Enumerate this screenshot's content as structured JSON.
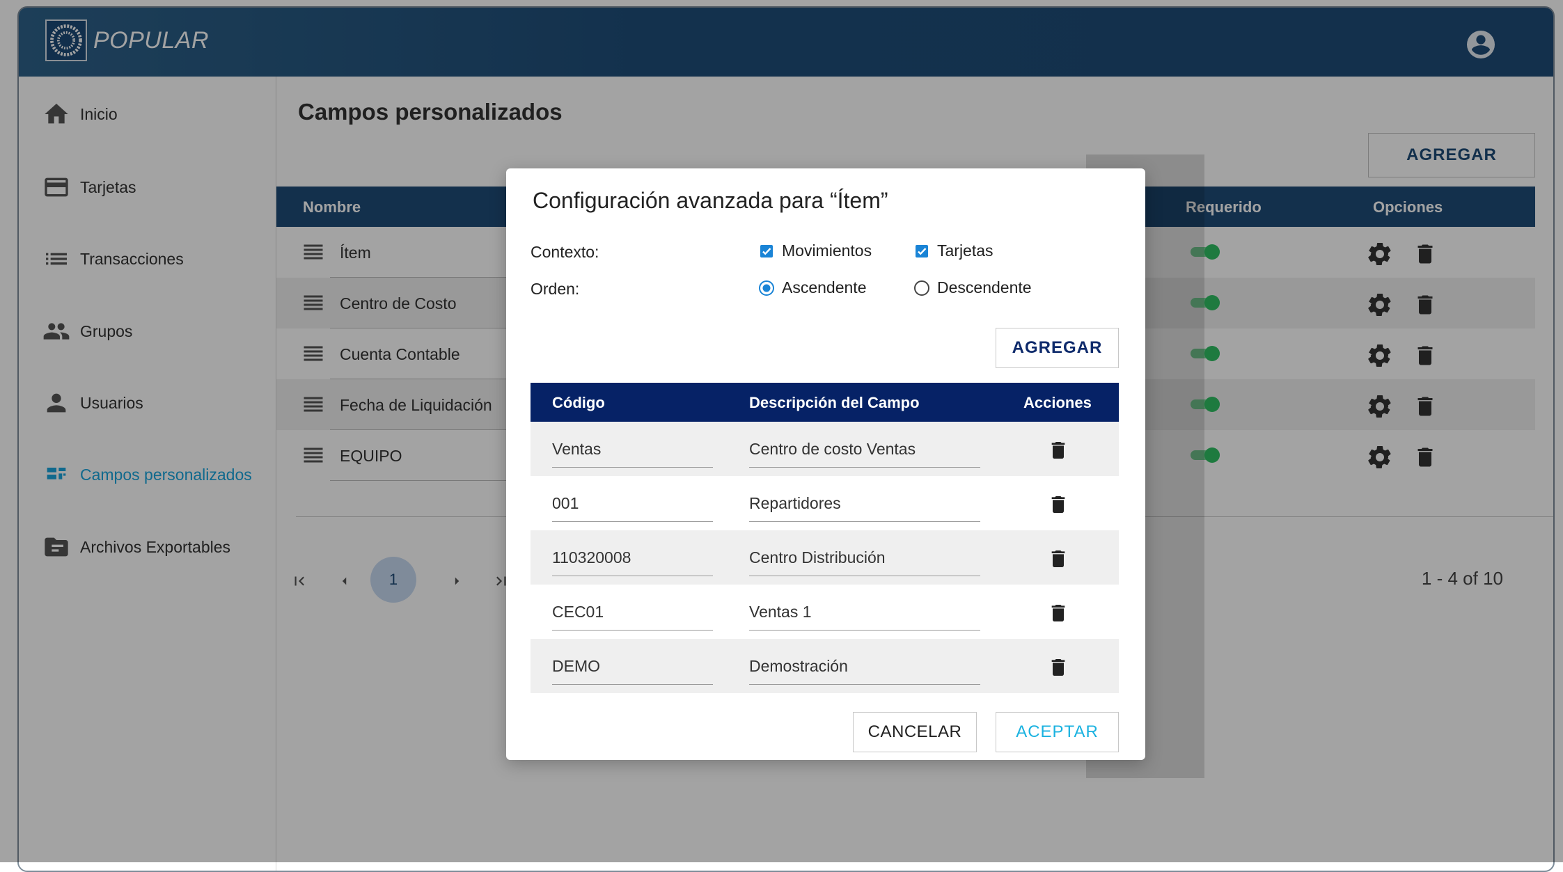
{
  "app": {
    "brand": "POPULAR"
  },
  "icons": {
    "logo": "popular-logo-icon",
    "account": "account-circle-icon",
    "home": "home-icon",
    "card": "credit-card-icon",
    "list": "list-icon",
    "group": "group-icon",
    "person": "person-icon",
    "custom": "custom-fields-icon",
    "folder": "folder-icon",
    "drag": "drag-handle-icon",
    "gear": "gear-icon",
    "trash": "trash-icon"
  },
  "colors": {
    "primary": "#1e4b78",
    "dialog_header": "#062266",
    "accent": "#1aa5dd",
    "toggle_on": "#2fbf63"
  },
  "sidebar": {
    "items": [
      {
        "label": "Inicio",
        "icon": "home-icon"
      },
      {
        "label": "Tarjetas",
        "icon": "credit-card-icon"
      },
      {
        "label": "Transacciones",
        "icon": "list-icon"
      },
      {
        "label": "Grupos",
        "icon": "group-icon"
      },
      {
        "label": "Usuarios",
        "icon": "person-icon"
      },
      {
        "label": "Campos personalizados",
        "icon": "custom-fields-icon",
        "active": true
      },
      {
        "label": "Archivos Exportables",
        "icon": "folder-icon"
      }
    ]
  },
  "main": {
    "title": "Campos personalizados",
    "add_label": "AGREGAR",
    "columns": {
      "name": "Nombre",
      "required": "Requerido",
      "options": "Opciones"
    },
    "rows": [
      {
        "name": "Ítem",
        "required": true
      },
      {
        "name": "Centro de Costo",
        "required": true
      },
      {
        "name": "Cuenta Contable",
        "required": true
      },
      {
        "name": "Fecha de Liquidación",
        "required": true
      },
      {
        "name": "EQUIPO",
        "required": true
      }
    ],
    "pagination": {
      "current_page": "1",
      "range": "1 - 4 of 10"
    }
  },
  "dialog": {
    "title": "Configuración avanzada para “Ítem”",
    "context_label": "Contexto:",
    "order_label": "Orden:",
    "context_options": [
      {
        "label": "Movimientos",
        "checked": true
      },
      {
        "label": "Tarjetas",
        "checked": true
      }
    ],
    "order_options": [
      {
        "label": "Ascendente",
        "selected": true
      },
      {
        "label": "Descendente",
        "selected": false
      }
    ],
    "add_label": "AGREGAR",
    "columns": {
      "code": "Código",
      "description": "Descripción del Campo",
      "actions": "Acciones"
    },
    "rows": [
      {
        "code": "Ventas",
        "description": "Centro de costo Ventas"
      },
      {
        "code": "001",
        "description": "Repartidores"
      },
      {
        "code": "110320008",
        "description": "Centro Distribución"
      },
      {
        "code": "CEC01",
        "description": "Ventas 1"
      },
      {
        "code": "DEMO",
        "description": "Demostración"
      }
    ],
    "cancel_label": "CANCELAR",
    "accept_label": "ACEPTAR"
  }
}
